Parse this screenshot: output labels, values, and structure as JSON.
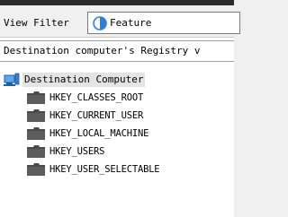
{
  "filter": {
    "label": "View Filter",
    "selected": "Feature",
    "icon": "pie-chart-icon"
  },
  "path_bar": {
    "text": "Destination computer's Registry v"
  },
  "tree": {
    "root": {
      "label": "Destination Computer",
      "icon": "computer-icon"
    },
    "items": [
      {
        "label": "HKEY_CLASSES_ROOT",
        "icon": "folder-icon"
      },
      {
        "label": "HKEY_CURRENT_USER",
        "icon": "folder-icon"
      },
      {
        "label": "HKEY_LOCAL_MACHINE",
        "icon": "folder-icon"
      },
      {
        "label": "HKEY_USERS",
        "icon": "folder-icon"
      },
      {
        "label": "HKEY_USER_SELECTABLE",
        "icon": "folder-icon"
      }
    ]
  },
  "colors": {
    "folder": "#4a4a4a",
    "pie_blue": "#2e7fd9",
    "selection_bg": "#e4e4e4"
  }
}
